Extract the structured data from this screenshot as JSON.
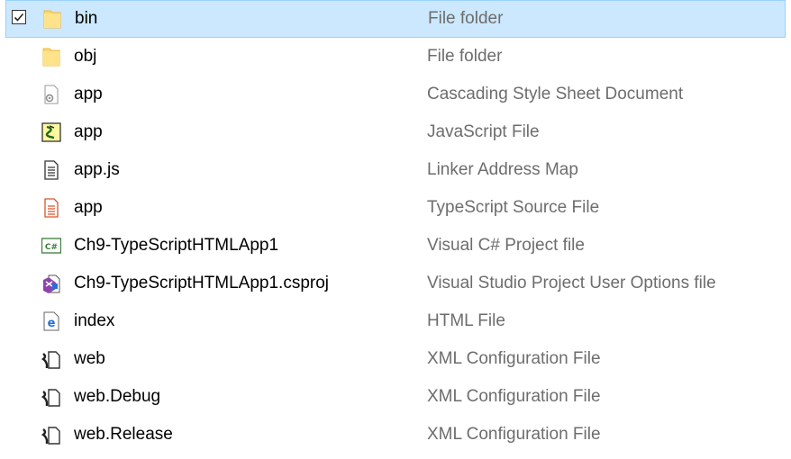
{
  "files": [
    {
      "name": "bin",
      "type": "File folder",
      "icon": "folder-icon",
      "selected": true
    },
    {
      "name": "obj",
      "type": "File folder",
      "icon": "folder-icon"
    },
    {
      "name": "app",
      "type": "Cascading Style Sheet Document",
      "icon": "css-file-icon"
    },
    {
      "name": "app",
      "type": "JavaScript File",
      "icon": "javascript-file-icon"
    },
    {
      "name": "app.js",
      "type": "Linker Address Map",
      "icon": "text-file-icon"
    },
    {
      "name": "app",
      "type": "TypeScript Source File",
      "icon": "typescript-file-icon"
    },
    {
      "name": "Ch9-TypeScriptHTMLApp1",
      "type": "Visual C# Project file",
      "icon": "csharp-project-icon"
    },
    {
      "name": "Ch9-TypeScriptHTMLApp1.csproj",
      "type": "Visual Studio Project User Options file",
      "icon": "vs-user-options-icon"
    },
    {
      "name": "index",
      "type": "HTML File",
      "icon": "html-file-icon"
    },
    {
      "name": "web",
      "type": "XML Configuration File",
      "icon": "xml-config-icon"
    },
    {
      "name": "web.Debug",
      "type": "XML Configuration File",
      "icon": "xml-config-icon"
    },
    {
      "name": "web.Release",
      "type": "XML Configuration File",
      "icon": "xml-config-icon"
    }
  ],
  "colors": {
    "selection_bg": "#cce8ff",
    "selection_border": "#99d1ff",
    "folder": "#ffd866",
    "type_text": "#6d6d6d"
  }
}
